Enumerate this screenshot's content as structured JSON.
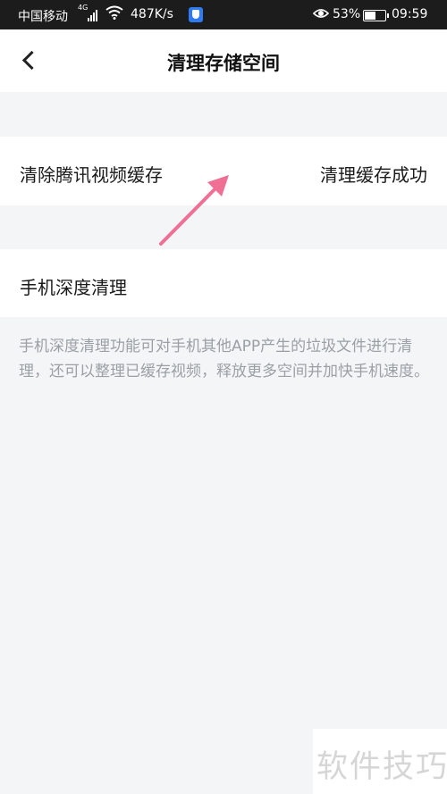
{
  "status_bar": {
    "carrier": "中国移动",
    "network": "4G",
    "speed": "487K/s",
    "battery": "53%",
    "time": "09:59"
  },
  "header": {
    "title": "清理存储空间"
  },
  "rows": [
    {
      "label": "清除腾讯视频缓存",
      "value": "清理缓存成功"
    },
    {
      "label": "手机深度清理"
    }
  ],
  "description": "手机深度清理功能可对手机其他APP产生的垃圾文件进行清理，还可以整理已缓存视频，释放更多空间并加快手机速度。",
  "annotation": {
    "arrow_color": "#ef6f95"
  },
  "watermark": "软件技巧"
}
